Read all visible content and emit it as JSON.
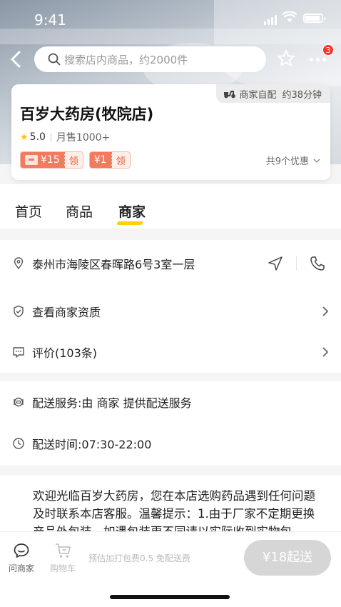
{
  "status_bar": {
    "time": "9:41"
  },
  "header": {
    "search_placeholder": "搜索店内商品，约2000件",
    "more_badge_count": "3"
  },
  "store": {
    "name": "百岁大药房(牧院店)",
    "delivery_tag": "商家自配",
    "delivery_time": "约38分钟",
    "rating": "5.0",
    "monthly_sales": "月售1000+",
    "coupons": [
      {
        "amount": "¥15",
        "action": "领"
      },
      {
        "amount": "¥1",
        "action": "领"
      }
    ],
    "promo_summary": "共9个优惠"
  },
  "tabs": [
    {
      "label": "首页"
    },
    {
      "label": "商品"
    },
    {
      "label": "商家"
    }
  ],
  "merchant": {
    "address": "泰州市海陵区春晖路6号3室一层",
    "qualification": "查看商家资质",
    "reviews": "评价(103条)",
    "delivery_service": "配送服务:由 商家 提供配送服务",
    "delivery_hours": "配送时间:07:30-22:00",
    "notice": "欢迎光临百岁大药房，您在本店选购药品遇到任何问题及时联系本店客服。温馨提示：1.由于厂家不定期更换产品外包装，如遇包装更不同请以实际收到实物包"
  },
  "bottom_bar": {
    "contact_label": "问商家",
    "cart_label": "购物车",
    "fee_text": "预估加打包费0.5 免配送费",
    "start_button": "¥18起送"
  },
  "colors": {
    "accent_yellow": "#ffd000",
    "coupon_orange": "#f27a5e",
    "badge_red": "#f0372e",
    "disabled_button": "#d6d6d6"
  }
}
